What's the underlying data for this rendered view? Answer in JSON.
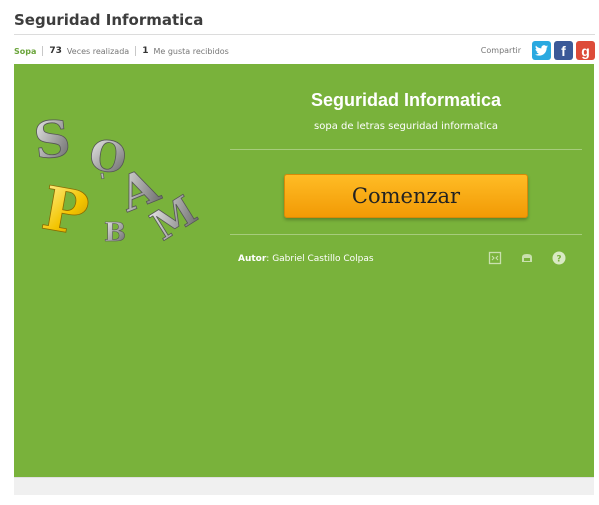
{
  "page": {
    "title": "Seguridad Informatica"
  },
  "meta": {
    "category": "Sopa",
    "plays_count": "73",
    "plays_label": "Veces realizada",
    "likes_count": "1",
    "likes_label": "Me gusta recibidos"
  },
  "share": {
    "label": "Compartir",
    "icons": [
      "twitter-icon",
      "facebook-icon",
      "google-plus-icon"
    ]
  },
  "game": {
    "logo_letters": "SOPA",
    "title": "Seguridad Informatica",
    "description": "sopa de letras seguridad informatica",
    "start_label": "Comenzar",
    "author_label": "Autor",
    "author_name": ": Gabriel Castillo Colpas",
    "tools": [
      "fullscreen-icon",
      "print-icon",
      "help-icon"
    ]
  },
  "colors": {
    "panel_bg": "#79b23b",
    "button_orange": "#f7a80d",
    "category_green": "#6aa43a"
  }
}
